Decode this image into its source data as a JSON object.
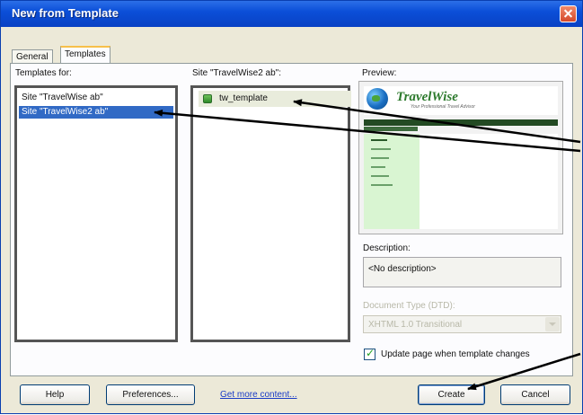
{
  "window": {
    "title": "New from Template"
  },
  "tabs": [
    {
      "label": "General"
    },
    {
      "label": "Templates"
    }
  ],
  "templates_for": {
    "label": "Templates for:",
    "items": [
      "Site \"TravelWise ab\"",
      "Site \"TravelWise2 ab\""
    ],
    "selected_index": 1
  },
  "site_panel": {
    "label": "Site \"TravelWise2 ab\":",
    "items": [
      "tw_template"
    ]
  },
  "preview": {
    "label": "Preview:",
    "logo_text": "TravelWise",
    "tagline": "Your Professional Travel Advisor"
  },
  "description": {
    "label": "Description:",
    "value": "<No description>"
  },
  "doc_type": {
    "label": "Document Type (DTD):",
    "value": "XHTML 1.0 Transitional"
  },
  "update_checkbox": {
    "label": "Update page when template changes",
    "checked": true
  },
  "buttons": {
    "help": "Help",
    "preferences": "Preferences...",
    "get_more": "Get more content...",
    "create": "Create",
    "cancel": "Cancel"
  },
  "colors": {
    "titlebar": "#0b4fd8",
    "selection": "#316ac5",
    "preview_green": "#2d7a2d"
  }
}
